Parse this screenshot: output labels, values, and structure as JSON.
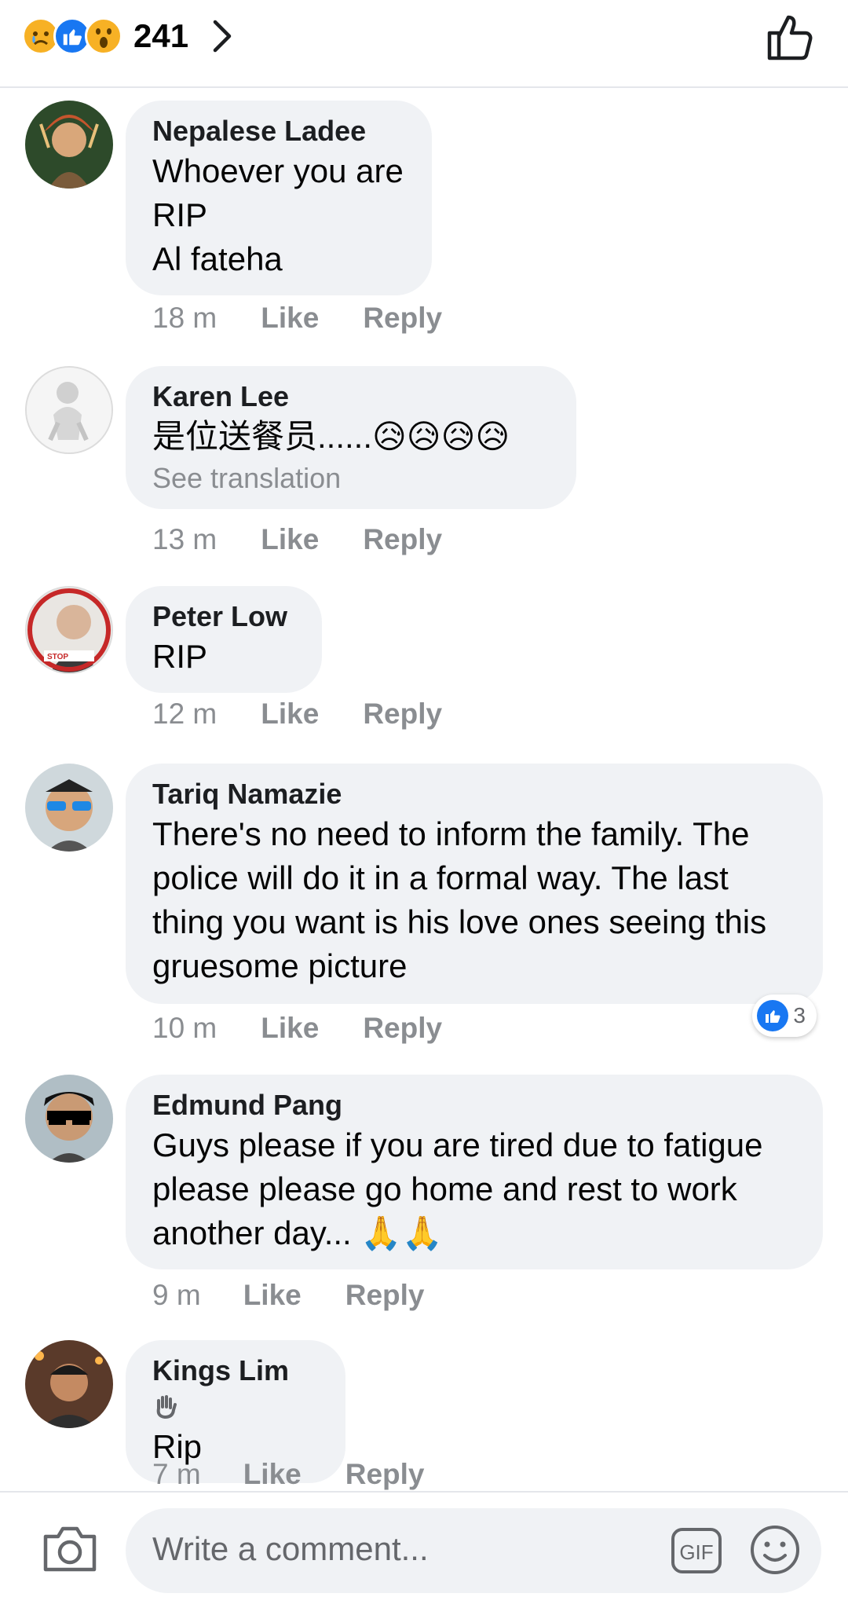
{
  "header": {
    "reaction_count": "241",
    "reactions": [
      "sad-reaction",
      "like-reaction",
      "wow-reaction"
    ]
  },
  "comments": [
    {
      "author": "Nepalese Ladee",
      "text": "Whoever you are\nRIP\nAl fateha",
      "time": "18 m",
      "like": "Like",
      "reply": "Reply"
    },
    {
      "author": "Karen Lee",
      "text": "是位送餐员......😥😥😥😥",
      "see_translation": "See translation",
      "time": "13 m",
      "like": "Like",
      "reply": "Reply"
    },
    {
      "author": "Peter Low",
      "text": "RIP",
      "time": "12 m",
      "like": "Like",
      "reply": "Reply"
    },
    {
      "author": "Tariq Namazie",
      "text": "There's no need to inform the family. The police will do it in a formal way. The last thing you want is his love ones seeing this gruesome picture",
      "time": "10 m",
      "like": "Like",
      "reply": "Reply",
      "reaction_count": "3"
    },
    {
      "author": "Edmund Pang",
      "text": "Guys please if you are tired due to fatigue please please go home and rest to work another day... 🙏🙏",
      "time": "9 m",
      "like": "Like",
      "reply": "Reply"
    },
    {
      "author": "Kings Lim",
      "text": "Rip",
      "time": "7 m",
      "like": "Like",
      "reply": "Reply"
    }
  ],
  "composer": {
    "placeholder": "Write a comment...",
    "gif_label": "GIF"
  },
  "colors": {
    "like_blue": "#1877f2",
    "bubble_bg": "#f0f2f5",
    "meta_gray": "#8a8d91",
    "sad_yellow": "#f7b125"
  }
}
